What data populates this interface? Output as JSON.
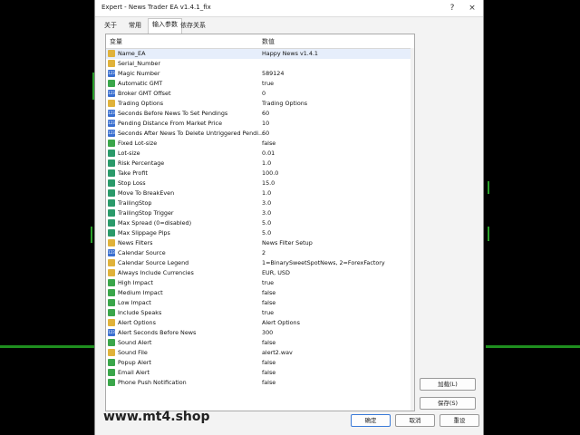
{
  "window": {
    "title": "Expert - News Trader EA v1.4.1_fix",
    "help_glyph": "?",
    "close_glyph": "×"
  },
  "tabs": [
    {
      "label": "关于"
    },
    {
      "label": "常用"
    },
    {
      "label": "输入参数"
    },
    {
      "label": "依存关系"
    }
  ],
  "table": {
    "headers": {
      "variable": "变量",
      "value": "数值"
    },
    "rows": [
      {
        "name": "Name_EA",
        "value": "Happy News v1.4.1",
        "type": "str"
      },
      {
        "name": "Serial_Number",
        "value": "",
        "type": "str"
      },
      {
        "name": "Magic Number",
        "value": "589124",
        "type": "int"
      },
      {
        "name": "Automatic GMT",
        "value": "true",
        "type": "bool"
      },
      {
        "name": "Broker GMT Offset",
        "value": "0",
        "type": "int"
      },
      {
        "name": "Trading Options",
        "value": "Trading Options",
        "type": "str"
      },
      {
        "name": "Seconds Before News To Set Pendings",
        "value": "60",
        "type": "int"
      },
      {
        "name": "Pending Distance From Market Price",
        "value": "10",
        "type": "int"
      },
      {
        "name": "Seconds After News To Delete Untriggered Pendi...",
        "value": "60",
        "type": "int"
      },
      {
        "name": "Fixed Lot-size",
        "value": "false",
        "type": "bool"
      },
      {
        "name": "Lot-size",
        "value": "0.01",
        "type": "dbl"
      },
      {
        "name": "Risk Percentage",
        "value": "1.0",
        "type": "dbl"
      },
      {
        "name": "Take Profit",
        "value": "100.0",
        "type": "dbl"
      },
      {
        "name": "Stop Loss",
        "value": "15.0",
        "type": "dbl"
      },
      {
        "name": "Move To BreakEven",
        "value": "1.0",
        "type": "dbl"
      },
      {
        "name": "TrailingStop",
        "value": "3.0",
        "type": "dbl"
      },
      {
        "name": "TrailingStop Trigger",
        "value": "3.0",
        "type": "dbl"
      },
      {
        "name": "Max Spread (0=disabled)",
        "value": "5.0",
        "type": "dbl"
      },
      {
        "name": "Max Slippage Pips",
        "value": "5.0",
        "type": "dbl"
      },
      {
        "name": "News Filters",
        "value": "News Filter Setup",
        "type": "str"
      },
      {
        "name": "Calendar Source",
        "value": "2",
        "type": "int"
      },
      {
        "name": "Calendar Source Legend",
        "value": "1=BinarySweetSpotNews, 2=ForexFactory",
        "type": "str"
      },
      {
        "name": "Always Include Currencies",
        "value": "EUR, USD",
        "type": "str"
      },
      {
        "name": "High Impact",
        "value": "true",
        "type": "bool"
      },
      {
        "name": "Medium Impact",
        "value": "false",
        "type": "bool"
      },
      {
        "name": "Low Impact",
        "value": "false",
        "type": "bool"
      },
      {
        "name": "Include Speaks",
        "value": "true",
        "type": "bool"
      },
      {
        "name": "Alert Options",
        "value": "Alert Options",
        "type": "str"
      },
      {
        "name": "Alert Seconds Before News",
        "value": "300",
        "type": "int"
      },
      {
        "name": "Sound Alert",
        "value": "false",
        "type": "bool"
      },
      {
        "name": "Sound File",
        "value": "alert2.wav",
        "type": "str"
      },
      {
        "name": "Popup Alert",
        "value": "false",
        "type": "bool"
      },
      {
        "name": "Email Alert",
        "value": "false",
        "type": "bool"
      },
      {
        "name": "Phone Push Notification",
        "value": "false",
        "type": "bool"
      }
    ]
  },
  "buttons": {
    "load": "加载(L)",
    "save": "保存(S)",
    "ok": "确定",
    "cancel": "取消",
    "reset": "重设"
  },
  "watermark": "www.mt4.shop",
  "colors": {
    "accent": "#3a7ad8",
    "int_icon": "#3a6fd0",
    "str_icon": "#e0b23a",
    "bool_icon": "#3aa64a",
    "dbl_icon": "#2a9a6a"
  }
}
